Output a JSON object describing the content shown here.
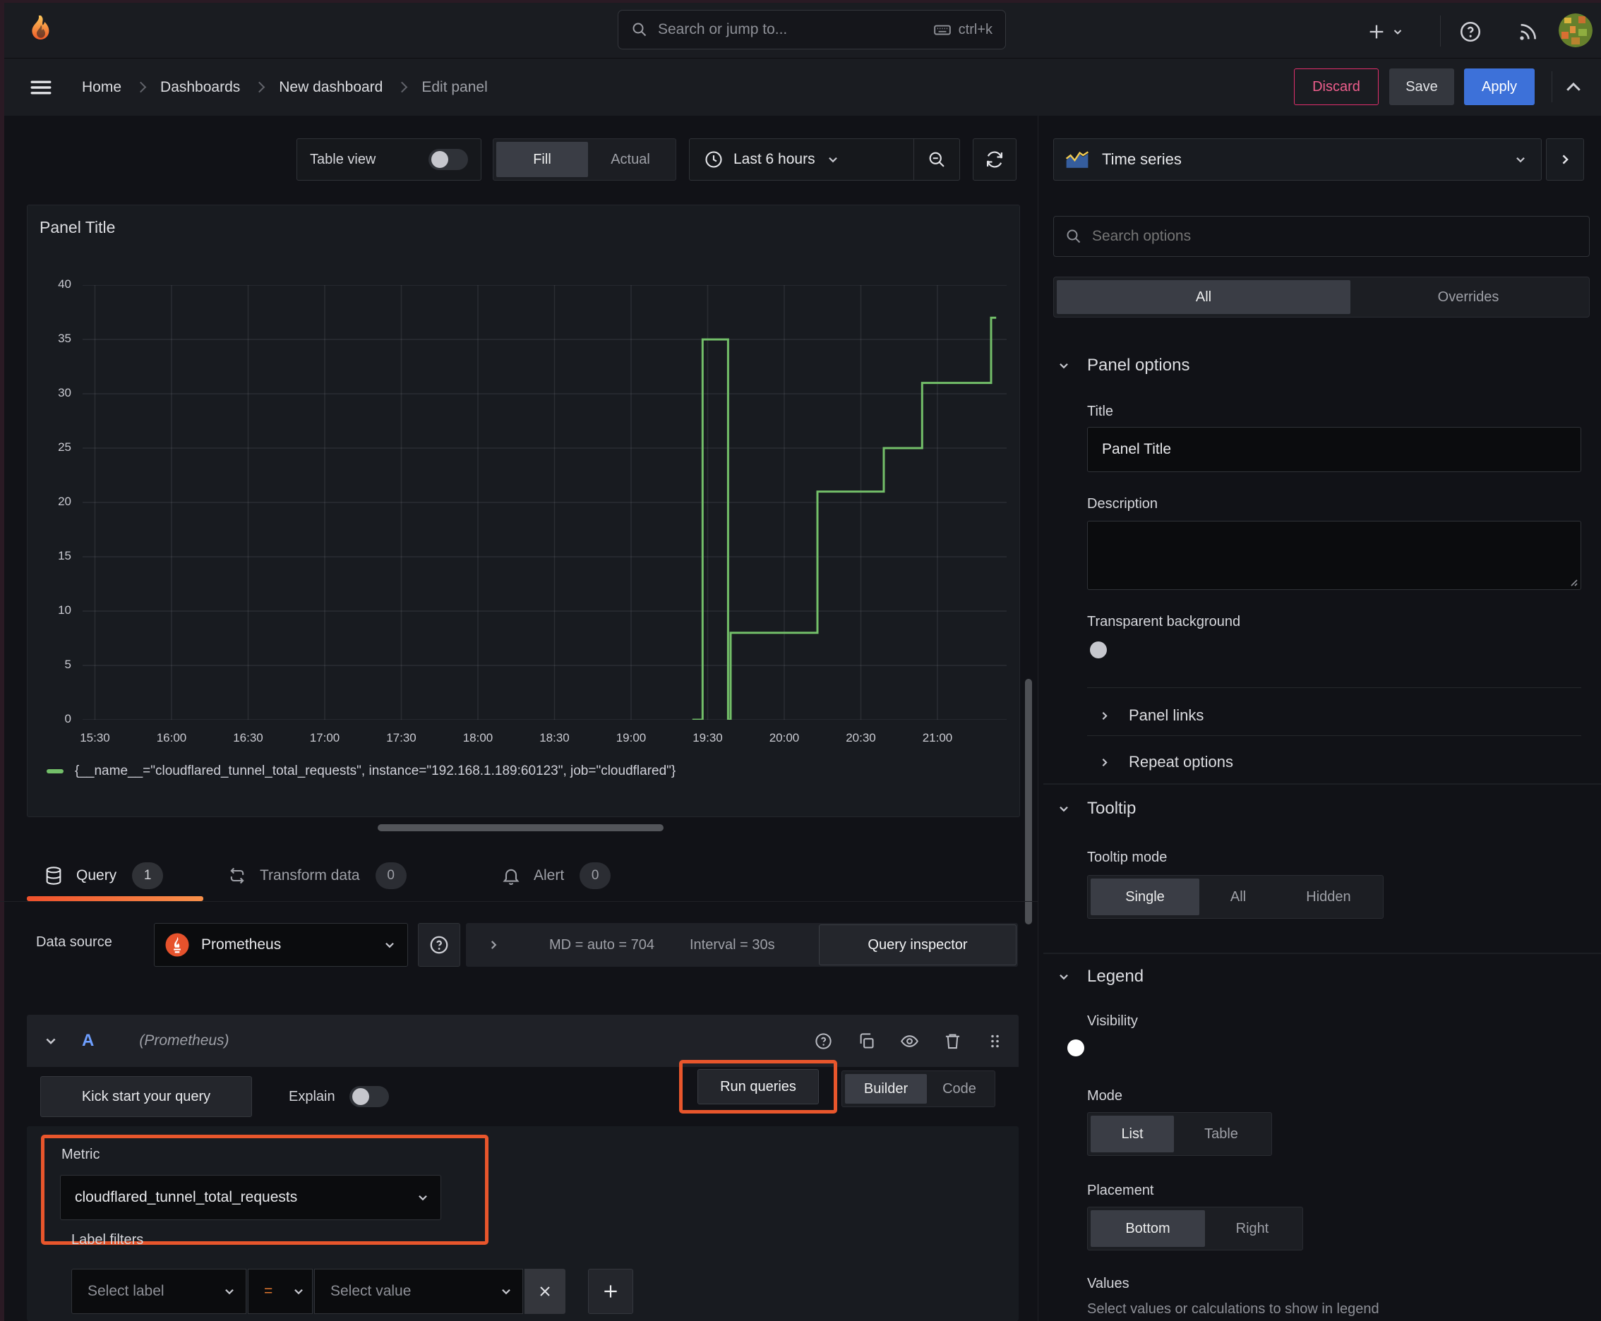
{
  "topnav": {
    "search_placeholder": "Search or jump to...",
    "shortcut": "ctrl+k"
  },
  "breadcrumb": {
    "items": [
      "Home",
      "Dashboards",
      "New dashboard",
      "Edit panel"
    ]
  },
  "actions": {
    "discard": "Discard",
    "save": "Save",
    "apply": "Apply"
  },
  "toolbar": {
    "table_view": "Table view",
    "fill": "Fill",
    "actual": "Actual",
    "time_range": "Last 6 hours"
  },
  "panel": {
    "title": "Panel Title"
  },
  "chart_data": {
    "type": "line",
    "variant": "stepped",
    "title": "Panel Title",
    "xlabel": "",
    "ylabel": "",
    "x_ticks": [
      "15:30",
      "16:00",
      "16:30",
      "17:00",
      "17:30",
      "18:00",
      "18:30",
      "19:00",
      "19:30",
      "20:00",
      "20:30",
      "21:00"
    ],
    "y_ticks": [
      40,
      35,
      30,
      25,
      20,
      15,
      10,
      5,
      0
    ],
    "ylim": [
      0,
      40
    ],
    "grid": true,
    "legend_position": "bottom",
    "series": [
      {
        "name": "{__name__=\"cloudflared_tunnel_total_requests\", instance=\"192.168.1.189:60123\", job=\"cloudflared\"}",
        "color": "#73bf69",
        "points": [
          [
            "19:24",
            0
          ],
          [
            "19:28",
            35
          ],
          [
            "19:38",
            0
          ],
          [
            "19:39",
            8
          ],
          [
            "20:13",
            21
          ],
          [
            "20:39",
            25
          ],
          [
            "20:54",
            31
          ],
          [
            "21:21",
            37
          ],
          [
            "21:23",
            37
          ]
        ]
      }
    ]
  },
  "tabs": [
    {
      "label": "Query",
      "count": "1"
    },
    {
      "label": "Transform data",
      "count": "0"
    },
    {
      "label": "Alert",
      "count": "0"
    }
  ],
  "datasource": {
    "label": "Data source",
    "name": "Prometheus",
    "md": "MD = auto = 704",
    "interval": "Interval = 30s",
    "inspector": "Query inspector"
  },
  "query": {
    "ref": "A",
    "ds_hint": "(Prometheus)",
    "kickstart": "Kick start your query",
    "explain": "Explain",
    "run_queries": "Run queries",
    "builder": "Builder",
    "code": "Code",
    "metric_label": "Metric",
    "metric_value": "cloudflared_tunnel_total_requests",
    "label_filters_label": "Label filters",
    "select_label_placeholder": "Select label",
    "operator": "=",
    "select_value_placeholder": "Select value"
  },
  "sidebar": {
    "panel_type": "Time series",
    "search_placeholder": "Search options",
    "tab_all": "All",
    "tab_overrides": "Overrides",
    "panel_options": "Panel options",
    "title_label": "Title",
    "title_value": "Panel Title",
    "description_label": "Description",
    "transparent_label": "Transparent background",
    "panel_links": "Panel links",
    "repeat_options": "Repeat options",
    "tooltip_heading": "Tooltip",
    "tooltip_mode_label": "Tooltip mode",
    "tooltip_single": "Single",
    "tooltip_all": "All",
    "tooltip_hidden": "Hidden",
    "legend_heading": "Legend",
    "visibility_label": "Visibility",
    "mode_label": "Mode",
    "mode_list": "List",
    "mode_table": "Table",
    "placement_label": "Placement",
    "placement_bottom": "Bottom",
    "placement_right": "Right",
    "values_label": "Values",
    "values_hint": "Select values or calculations to show in legend"
  },
  "colors": {
    "series_green": "#73bf69",
    "highlight_orange": "#e8562c",
    "apply_blue": "#3d71d9",
    "discard_red": "#e02f6c"
  }
}
